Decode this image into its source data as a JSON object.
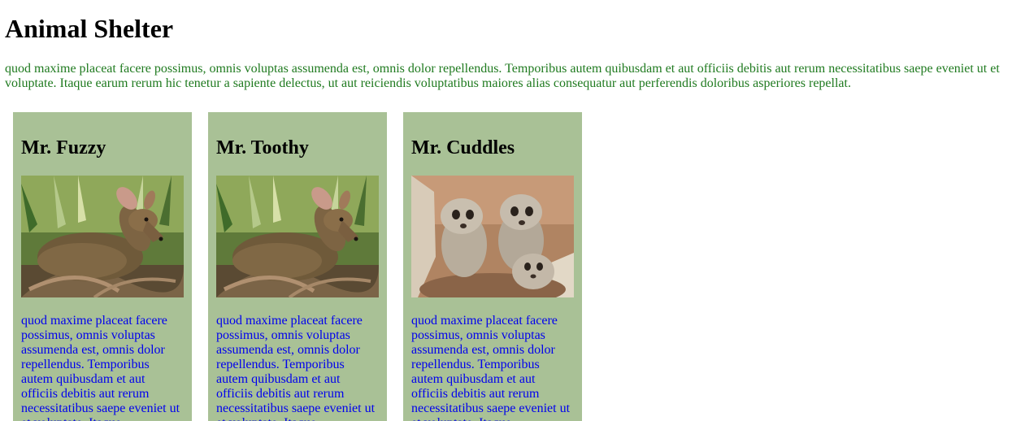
{
  "page": {
    "title": "Animal Shelter",
    "intro": "quod maxime placeat facere possimus, omnis voluptas assumenda est, omnis dolor repellendus. Temporibus autem quibusdam et aut officiis debitis aut rerum necessitatibus saepe eveniet ut et voluptate. Itaque earum rerum hic tenetur a sapiente delectus, ut aut reiciendis voluptatibus maiores alias consequatur aut perferendis doloribus asperiores repellat."
  },
  "colors": {
    "intro_text": "#1f7a1f",
    "card_background": "#a9c196",
    "card_text": "#0000ee"
  },
  "animals": [
    {
      "name": "Mr. Fuzzy",
      "photo": "deer-photo",
      "description": "quod maxime placeat facere possimus, omnis voluptas assumenda est, omnis dolor repellendus. Temporibus autem quibusdam et aut officiis debitis aut rerum necessitatibus saepe eveniet ut et voluptate. Itaque"
    },
    {
      "name": "Mr. Toothy",
      "photo": "deer-photo",
      "description": "quod maxime placeat facere possimus, omnis voluptas assumenda est, omnis dolor repellendus. Temporibus autem quibusdam et aut officiis debitis aut rerum necessitatibus saepe eveniet ut et voluptate. Itaque"
    },
    {
      "name": "Mr. Cuddles",
      "photo": "meerkats-photo",
      "description": "quod maxime placeat facere possimus, omnis voluptas assumenda est, omnis dolor repellendus. Temporibus autem quibusdam et aut officiis debitis aut rerum necessitatibus saepe eveniet ut et voluptate. Itaque"
    }
  ]
}
